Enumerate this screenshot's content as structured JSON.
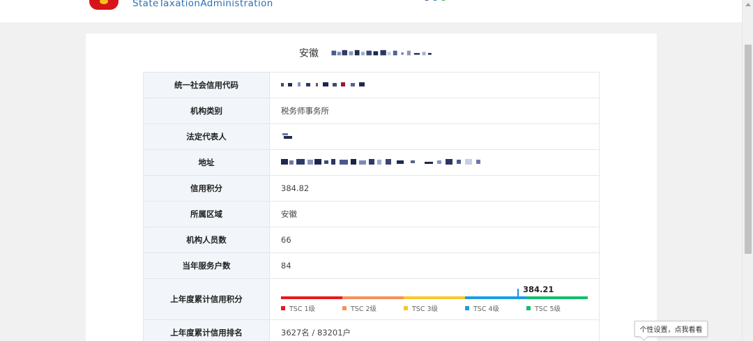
{
  "header": {
    "brand_en": "StateTaxationAdministration"
  },
  "record": {
    "title_prefix": "安徽",
    "rows": [
      {
        "key": "统一社会信用代码",
        "value": ""
      },
      {
        "key": "机构类别",
        "value": "税务师事务所"
      },
      {
        "key": "法定代表人",
        "value": ""
      },
      {
        "key": "地址",
        "value": ""
      },
      {
        "key": "信用积分",
        "value": "384.82"
      },
      {
        "key": "所属区域",
        "value": "安徽"
      },
      {
        "key": "机构人员数",
        "value": "66"
      },
      {
        "key": "当年服务户数",
        "value": "84"
      },
      {
        "key": "上年度累计信用积分",
        "value": ""
      },
      {
        "key": "上年度累计信用排名",
        "value": "3627名 / 83201户"
      }
    ]
  },
  "credit_bar": {
    "score": "384.21",
    "score_fraction": 0.77,
    "levels": [
      {
        "label": "TSC 1级",
        "color": "#e8191e"
      },
      {
        "label": "TSC 2级",
        "color": "#f5915a"
      },
      {
        "label": "TSC 3级",
        "color": "#f9c62b"
      },
      {
        "label": "TSC 4级",
        "color": "#1a9be6"
      },
      {
        "label": "TSC 5级",
        "color": "#12bf6a"
      }
    ]
  },
  "tooltip": {
    "text": "个性设置，点我看看"
  },
  "colors": {
    "brand_blue": "#2c6fb3",
    "label_bg": "#f2f6fa",
    "border": "#e3e6ea"
  }
}
